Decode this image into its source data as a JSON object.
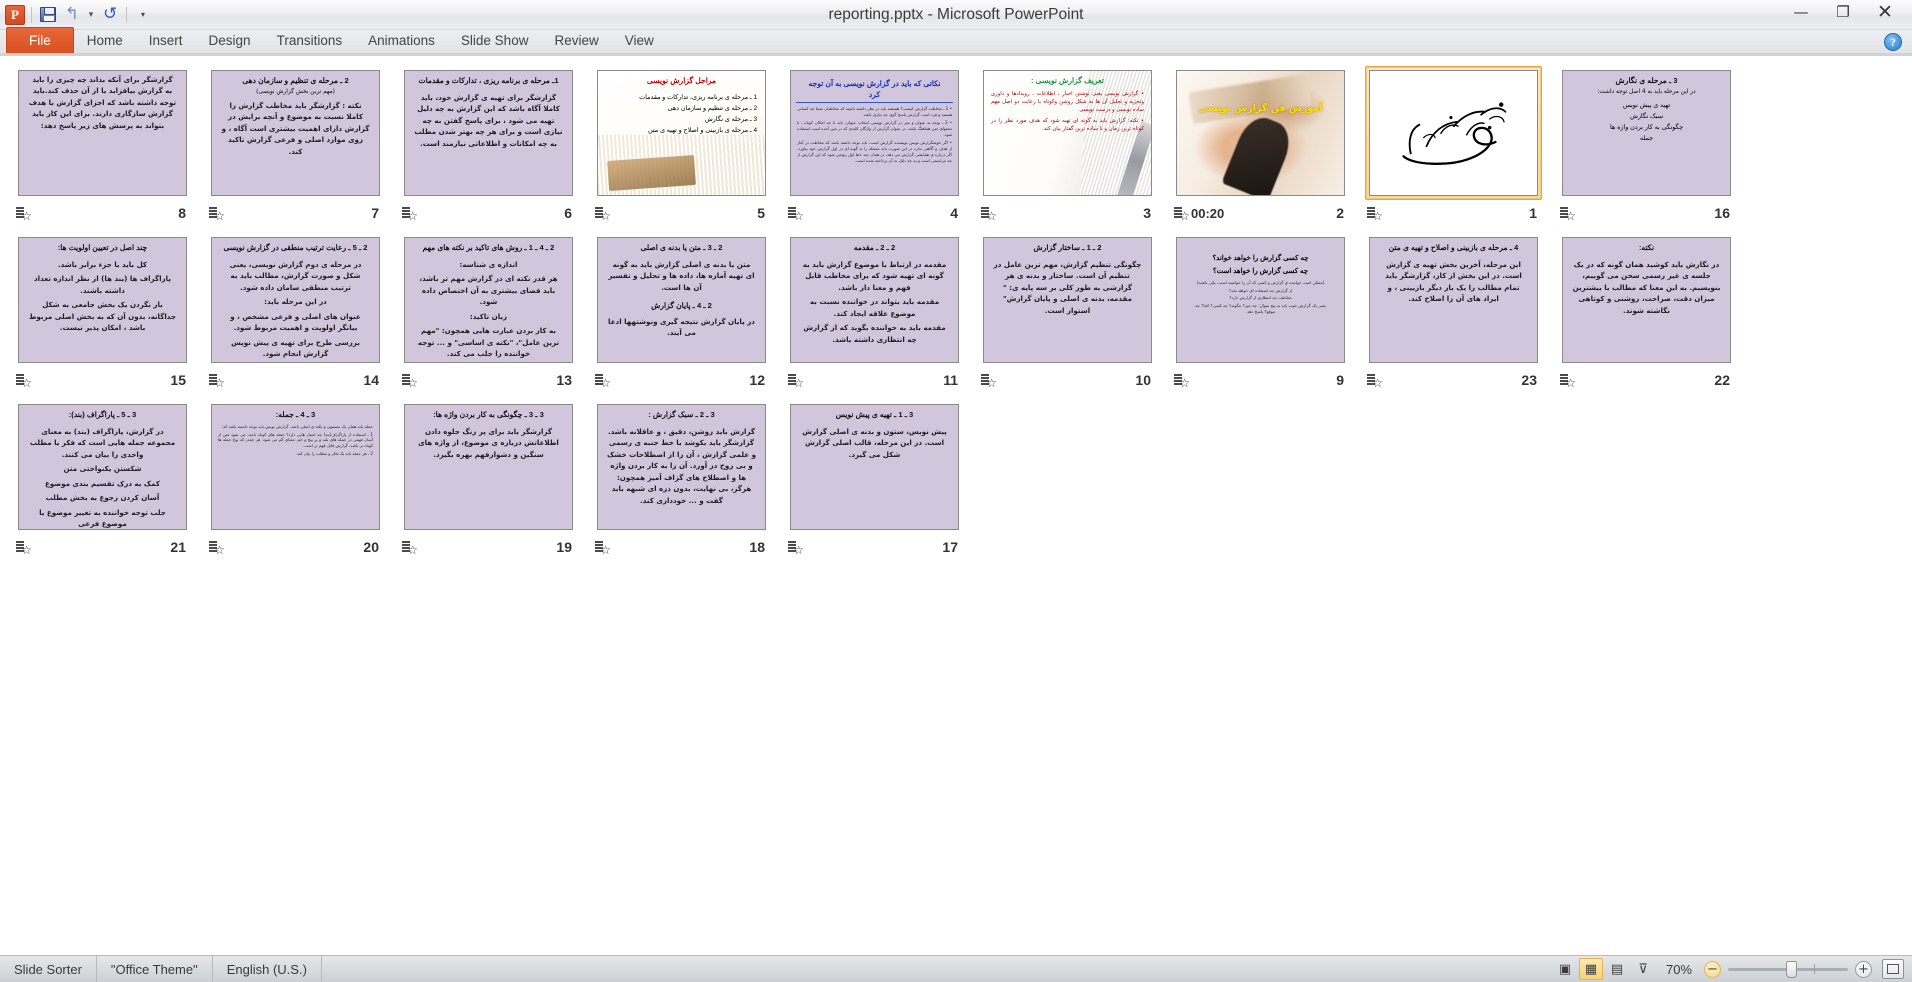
{
  "window": {
    "title": "reporting.pptx - Microsoft PowerPoint",
    "minimize": "—",
    "restore": "❐",
    "close": "✕",
    "help": "?"
  },
  "quick_access": {
    "logo": "P",
    "save": "save-icon",
    "undo": "↰",
    "undo_caret": "▾",
    "redo": "↻",
    "customize": "▾"
  },
  "ribbon": {
    "tabs": [
      {
        "label": "File",
        "active": true
      },
      {
        "label": "Home",
        "active": false
      },
      {
        "label": "Insert",
        "active": false
      },
      {
        "label": "Design",
        "active": false
      },
      {
        "label": "Transitions",
        "active": false
      },
      {
        "label": "Animations",
        "active": false
      },
      {
        "label": "Slide Show",
        "active": false
      },
      {
        "label": "Review",
        "active": false
      },
      {
        "label": "View",
        "active": false
      }
    ]
  },
  "status_bar": {
    "view_mode": "Slide Sorter",
    "theme": "\"Office Theme\"",
    "language": "English (U.S.)",
    "zoom_level": "70%",
    "zoom_out": "−",
    "zoom_in": "+",
    "view_buttons": [
      {
        "name": "normal-view",
        "glyph": "▣",
        "active": false
      },
      {
        "name": "slide-sorter-view",
        "glyph": "▦",
        "active": true
      },
      {
        "name": "reading-view",
        "glyph": "▤",
        "active": false
      },
      {
        "name": "slide-show-view",
        "glyph": "⊽",
        "active": false
      }
    ],
    "fit_to_window": "fit-slide-icon"
  },
  "slides": [
    {
      "number": "8",
      "type": "lavender-text",
      "selected": false,
      "timing": "",
      "body": "گزارشگر برای آنکه بداند چه چیزی را باید به گزارش بیافزاید یا از آن حذف کند.باید توجه داشته باشد که اجزای گزارش با هدف گزارش سازگاری دارند. برای این کار باید بتواند به پرسش های زیر پاسخ دهد:"
    },
    {
      "number": "7",
      "type": "lavender-title-body",
      "selected": false,
      "timing": "",
      "title": "2 ـ مرحله ی تنظیم و سازمان دهی",
      "subtitle": "(مهم ترین بخش گزارش نویسی)",
      "body": "نکته : گزارشگر باید مخاطب گزارش را کاملا نسبت به موضوع و آنچه برایش در گزارش دارای اهمیت بیشتری است آگاه ، و روی موارد اصلی و فرعی گزارش تاکید کند."
    },
    {
      "number": "6",
      "type": "lavender-title-body",
      "selected": false,
      "timing": "",
      "title": "1ـ مرحله ی برنامه ریزی ، تدارکات و مقدمات",
      "body": "گزارشگر برای تهیه ی گزارش خود، باید کاملا آگاه باشد که این گزارش به چه دلیل تهیه می شود ، برای پاسخ گفتن به چه نیازی است و برای هر چه بهتر شدن مطلب به چه امکانات و اطلاعاتی نیازمند است."
    },
    {
      "number": "5",
      "type": "books-photo",
      "selected": false,
      "timing": "",
      "title": "مراحل گزارش نویسی",
      "lines": [
        "1 ـ مرحله ی برنامه ریزی، تدارکات و مقدمات",
        "2 ـ مرحله ی تنظیم و سازمان دهی",
        "3 ـ مرحله ی نگارش",
        "4 ـ مرحله ی بازبینی و اصلاح و تهیه ی متن"
      ]
    },
    {
      "number": "4",
      "type": "lavender-dense",
      "selected": false,
      "timing": "",
      "title": "نکاتی که باید در گزارش نویسی به آن توجه کرد",
      "items": [
        "1 ـ مخاطب گزارش کیست؟ همیشه باید در نظر داشته باشید که مخاطبان شما چه کسانی هستند و فرد است گزارش پاسخ گوی چه نیازی باشد.",
        "2 ـ توجه به عنوان و تیتر در گزارش نویسی انتخاب عنوان، باید تا حد امکان کوتاه ، با محتوای متن هماهنگ باشد. در عنوان گزارش از واژگان کلیدی که در متن آمده است استفاده شود.",
        "اگر خوشگزارش نویس نویسنده گزارش است، باید توجه داشته باشد که مخاطب در آغاز از هدف و آگاهی ندارد در این صورت باید مسئله را به گونه ای در اول گزارش خود بیاورد. اگر درباره ی همایشی گزارش می دهد، در همان چند خط اول روشن شود که این گزارش از چه مراسمی است و به چه دلیل به آن پرداخته شده است."
      ]
    },
    {
      "number": "3",
      "type": "pen-photo-green",
      "selected": false,
      "timing": "",
      "title": "تعریف گزارش نویسی :",
      "items": [
        "گزارش نویسی یعنی نوشتن اخبار ، اطلاعات ، رویدادها و داوری وتجزیه و تحلیل آن ها به شکل روشن وکوتاه با رعایت دو اصل مهم ساده نویسی و درست نویسی",
        "نکته: گزارش باید به گونه ای تهیه شود که هدف مورد نظر را در کوتاه ترین زمان و با ساده ترین گفتار بیان کند."
      ]
    },
    {
      "number": "2",
      "type": "hand-photo",
      "selected": false,
      "timing": "00:20",
      "title": "آموزش فن گزارش نویسی"
    },
    {
      "number": "1",
      "type": "calligraphy",
      "selected": true,
      "timing": "",
      "title": "بسم الله الرحمن الرحیم"
    },
    {
      "number": "16",
      "type": "lavender-title-body",
      "selected": false,
      "timing": "",
      "title": "3 ـ مرحله ی نگارش",
      "subtitle": "در این مرحله باید به 4 اصل توجه داشت:",
      "lines": [
        "تهیه ی پیش نویس",
        "سبک نگارش",
        "چگونگی به کار بردن واژه ها",
        "جمله"
      ]
    },
    {
      "number": "15",
      "type": "lavender-title-body",
      "selected": false,
      "timing": "",
      "title": "چند اصل در تعیین اولویت ها:",
      "body": "کل باید با جزء برابر باشد.\nپاراگراف ها (بند ها) از نظر اندازه تعداد داشته باشند.\nبار نگردن یک بخش جامعی به شکل جداگانه، بدون آن که به بخش اصلی مربوط باشد ، امکان پذیر نیست."
    },
    {
      "number": "14",
      "type": "lavender-title-body",
      "selected": false,
      "timing": "",
      "title": "2 ـ 5 ـ رعایت ترتیب منطقی در گزارش نویسی",
      "body": "در مرحله ی دوم گزارش نویسی، یعنی شکل و صورت گزارش، مطالب باید به ترتیب منطقی سامان داده شود.\nدر این مرحله باید:\nعنوان های اصلی و فرعی مشخص ، و بیانگر اولویت و اهمیت مربوط شود.\nبررسی طرح برای تهیه ی پیش نویس گزارش انجام شود."
    },
    {
      "number": "13",
      "type": "lavender-title-body",
      "selected": false,
      "timing": "",
      "title": "2 ـ 4 ـ 1 ـ روش های تاکید بر نکته های مهم",
      "body": "اندازه ی شناسه:\nهر قدر نکته ای در گزارش مهم تر باشد، باید فضای بیشتری به آن اختصاص داده شود.\nزبان تاکید:\nبه کار بردن عبارت هایی همچون: \"مهم ترین عامل\"، \"نکته ی اساسی\" و ... توجه خواننده را جلب می کند."
    },
    {
      "number": "12",
      "type": "lavender-title-body",
      "selected": false,
      "timing": "",
      "title": "2 ـ 3 ـ متن یا بدنه ی اصلی",
      "body": "متن یا بدنه ی اصلی گزارش باید به گونه ای تهیه آماره ها، داده ها و تحلیل و تفسیر آن ها است.",
      "title2": "2 ـ 4 ـ پایان گزارش",
      "body2": "در پایان گزارش نتیجه گیری ونوشتهها ادعا می آیند."
    },
    {
      "number": "11",
      "type": "lavender-title-body",
      "selected": false,
      "timing": "",
      "title": "2 ـ 2 ـ مقدمه",
      "body": "مقدمه در ارتباط با موضوع گزارش باید به گونه ای تهیه شود که برای مخاطب قابل فهم و معنا دار باشد.\nمقدمه باید بتواند در خواننده نسبت به موضوع علاقه ایجاد کند.\nمقدمه باید به خواننده بگوید که از گزارش چه انتظاری داشته باشد."
    },
    {
      "number": "10",
      "type": "lavender-title-body",
      "selected": false,
      "timing": "",
      "title": "2 ـ 1 ـ ساختار گزارش",
      "body": "چگونگی تنظیم گزارش، مهم ترین عامل در تنظیم آن است. ساختار و بدنه ی هر گزارشی به طور کلی بر سه پایه ی: \" مقدمه، بدنه ی اصلی و پایان گزارش\" استوار است."
    },
    {
      "number": "9",
      "type": "lavender-questions",
      "selected": false,
      "timing": "",
      "lines": [
        "چه کسی گزارش را خواهد خواند؟",
        "چه کسی گزارش را خواهد است؟",
        "(ممکن است خواننده ی گزارش و کسی که آن را خواسته است، یکی باشند)",
        "از گزارش چه استفاده ای خواهد شد؟",
        "مخاطب چه انتظاری از گزارش دارد؟",
        "یعنی یک گزارش خوب باید به پنج سوال: چه چیز؟ چگونه؟ چه کسی؟ کجا؟ چه موقع؟ پاسخ دهد."
      ]
    },
    {
      "number": "23",
      "type": "lavender-title-body",
      "selected": false,
      "timing": "",
      "title": "4 ـ مرحله ی بازبینی و اصلاح و تهیه ی متن",
      "body": "این مرحله، آخرین بخش تهیه ی گزارش است. در این بخش از کار، گزارشگر باید تمام مطالب را یک بار دیگر بازبینی ، و ایراد های آن را اصلاح کند."
    },
    {
      "number": "22",
      "type": "lavender-title-body",
      "selected": false,
      "timing": "",
      "title": "نکته:",
      "body": "در نگارش باید کوشید همان گونه که در یک جلسه ی غیر رسمی سخن می گوییم، بنویسیم. به این معنا که مطالب با بیشترین میزان دقت، صراحت، روشنی و کوتاهی نگاشته شوند."
    },
    {
      "number": "21",
      "type": "lavender-title-body",
      "selected": false,
      "timing": "",
      "title": "3 ـ 5 ـ پاراگراف (بند):",
      "body": "در گزارش، پاراگراف (بند) به معنای مجموعه جمله هایی است که فکر یا مطلب واحدی را بیان می کنند.\nشکستن یکنواختی متن\nکمک به درک تقسیم بندی موضوع\nآسان کردن رجوع به بخش مطلب\nجلب توجه خواننده به تغییر موضوع یا موضوع فرعی"
    },
    {
      "number": "20",
      "type": "lavender-dense2",
      "selected": false,
      "timing": "",
      "title": "3 ـ 4 ـ جمله:",
      "items": [
        "جمله باید همان یک مضمون و نکته ی اصلی باشد. گزارش نویس باید توجه داشته باشد که:",
        "1 ـ استفاده از پاراگراف(بند) چه امتیاز هایی دارد؟ جمله های کوتاه باعث می شود متن از آسان فهمی در جمله های بلند و پر پیچ و خم، معنای گم می شود. هر چقدر که نوع جمله ها کوتاه تر باشد، گزارش قابل فهم تر است.",
        "2 ـ هر جمله باید یک فکر و مطلب را بیان کند."
      ]
    },
    {
      "number": "19",
      "type": "lavender-title-body",
      "selected": false,
      "timing": "",
      "title": "3 ـ 3 ـ چگونگی به کار بردن واژه ها:",
      "body": "گزارشگر باید برای پر رنگ جلوه دادن اطلاعاتش درباره ی موضوع، از واژه های سنگین و دشوارفهم بهره بگیرد."
    },
    {
      "number": "18",
      "type": "lavender-title-body",
      "selected": false,
      "timing": "",
      "title": "3 ـ 2 ـ سبک گزارش :",
      "body": "گزارش باید روشن، دقیق ، و عاقلانه باشد. گزارشگر باید بکوشد با خط جنبه ی رسمی و علمی گزارش ، آن را از اصطلاحات خشک و بی روح در آورد. آن را به کار بردن واژه ها و اصطلاح های گزاف آمیز همچون: هرگز، بی نهایت، بدون ذره ای شبهه باید گفت و ... خودداری کند."
    },
    {
      "number": "17",
      "type": "lavender-title-body",
      "selected": false,
      "timing": "",
      "title": "3 ـ 1 ـ تهیه ی پیش نویس",
      "body": "پیش نویس، ستون و بدنه ی اصلی گزارش است. در این مرحله، قالب اصلی گزارش شکل می گیرد."
    }
  ]
}
